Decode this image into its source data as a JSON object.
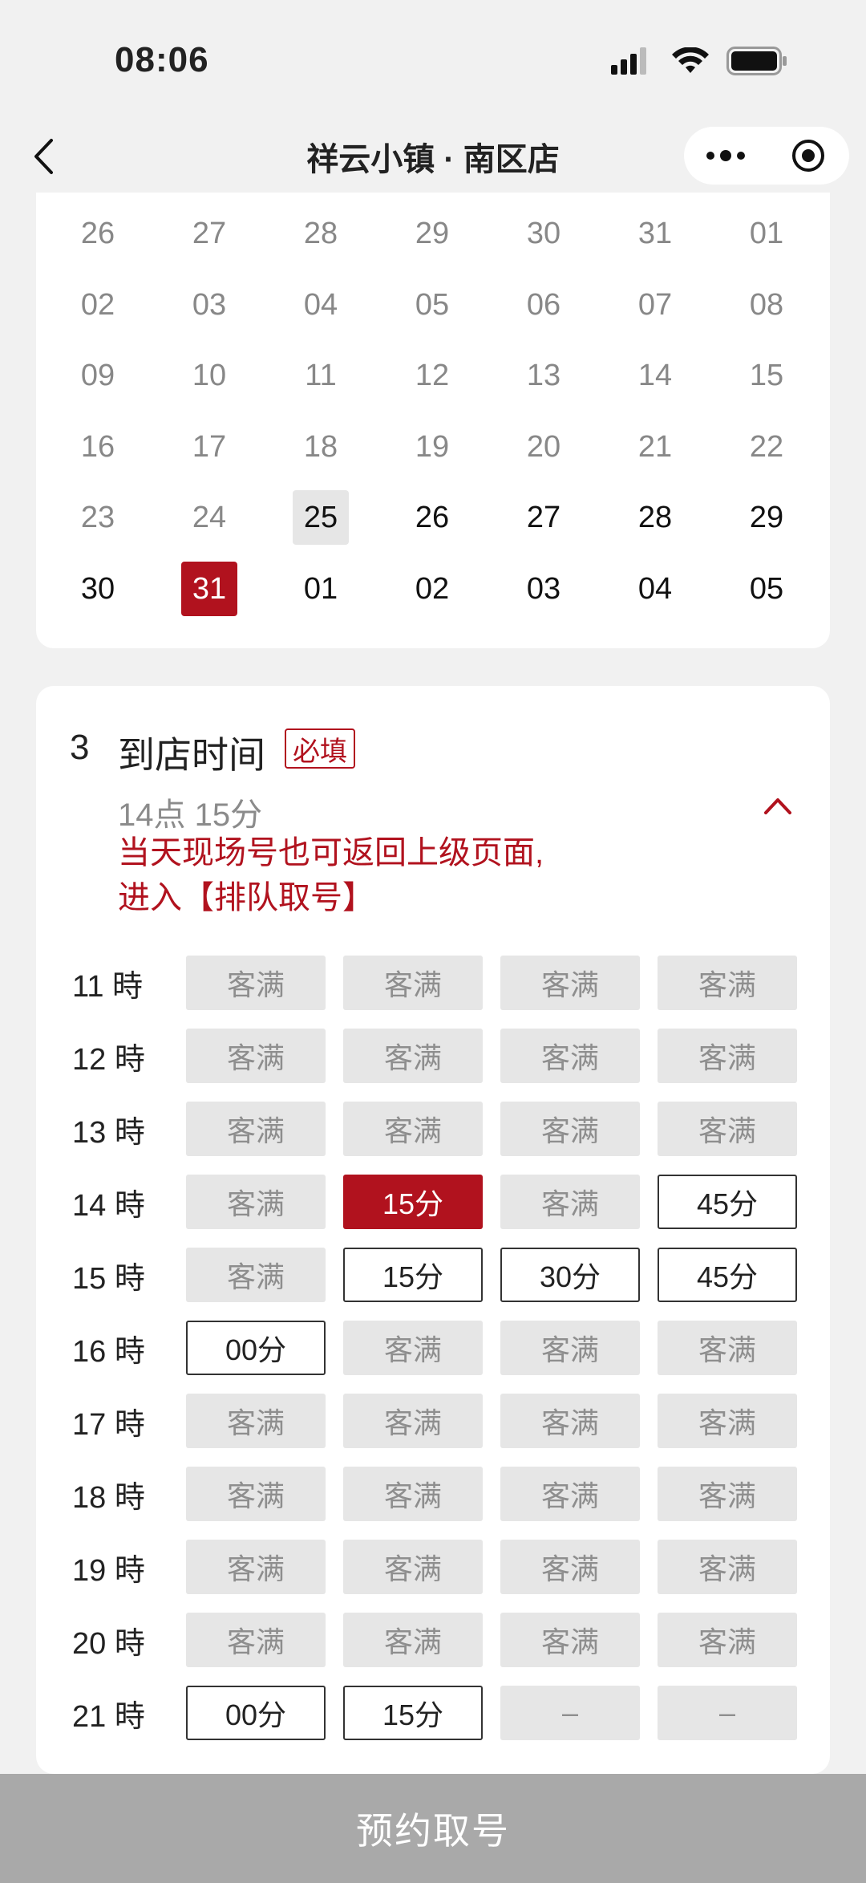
{
  "status": {
    "time": "08:06"
  },
  "nav": {
    "title": "祥云小镇 · 南区店"
  },
  "calendar": {
    "rows": [
      [
        {
          "d": "26",
          "s": "past"
        },
        {
          "d": "27",
          "s": "past"
        },
        {
          "d": "28",
          "s": "past"
        },
        {
          "d": "29",
          "s": "past"
        },
        {
          "d": "30",
          "s": "past"
        },
        {
          "d": "31",
          "s": "past"
        },
        {
          "d": "01",
          "s": "past"
        }
      ],
      [
        {
          "d": "02",
          "s": "past"
        },
        {
          "d": "03",
          "s": "past"
        },
        {
          "d": "04",
          "s": "past"
        },
        {
          "d": "05",
          "s": "past"
        },
        {
          "d": "06",
          "s": "past"
        },
        {
          "d": "07",
          "s": "past"
        },
        {
          "d": "08",
          "s": "past"
        }
      ],
      [
        {
          "d": "09",
          "s": "past"
        },
        {
          "d": "10",
          "s": "past"
        },
        {
          "d": "11",
          "s": "past"
        },
        {
          "d": "12",
          "s": "past"
        },
        {
          "d": "13",
          "s": "past"
        },
        {
          "d": "14",
          "s": "past"
        },
        {
          "d": "15",
          "s": "past"
        }
      ],
      [
        {
          "d": "16",
          "s": "past"
        },
        {
          "d": "17",
          "s": "past"
        },
        {
          "d": "18",
          "s": "past"
        },
        {
          "d": "19",
          "s": "past"
        },
        {
          "d": "20",
          "s": "past"
        },
        {
          "d": "21",
          "s": "past"
        },
        {
          "d": "22",
          "s": "past"
        }
      ],
      [
        {
          "d": "23",
          "s": "past"
        },
        {
          "d": "24",
          "s": "past"
        },
        {
          "d": "25",
          "s": "today"
        },
        {
          "d": "26",
          "s": "future"
        },
        {
          "d": "27",
          "s": "future"
        },
        {
          "d": "28",
          "s": "future"
        },
        {
          "d": "29",
          "s": "future"
        }
      ],
      [
        {
          "d": "30",
          "s": "future"
        },
        {
          "d": "31",
          "s": "selected"
        },
        {
          "d": "01",
          "s": "future"
        },
        {
          "d": "02",
          "s": "future"
        },
        {
          "d": "03",
          "s": "future"
        },
        {
          "d": "04",
          "s": "future"
        },
        {
          "d": "05",
          "s": "future"
        }
      ]
    ]
  },
  "time_section": {
    "step_number": "3",
    "title": "到店时间",
    "required_label": "必填",
    "selected_time": "14点 15分",
    "notice_line1": "当天现场号也可返回上级页面,",
    "notice_line2": "进入【排队取号】",
    "rows": [
      {
        "hour": "11 時",
        "slots": [
          {
            "t": "客满",
            "s": "full"
          },
          {
            "t": "客满",
            "s": "full"
          },
          {
            "t": "客满",
            "s": "full"
          },
          {
            "t": "客满",
            "s": "full"
          }
        ]
      },
      {
        "hour": "12 時",
        "slots": [
          {
            "t": "客满",
            "s": "full"
          },
          {
            "t": "客满",
            "s": "full"
          },
          {
            "t": "客满",
            "s": "full"
          },
          {
            "t": "客满",
            "s": "full"
          }
        ]
      },
      {
        "hour": "13 時",
        "slots": [
          {
            "t": "客满",
            "s": "full"
          },
          {
            "t": "客满",
            "s": "full"
          },
          {
            "t": "客满",
            "s": "full"
          },
          {
            "t": "客满",
            "s": "full"
          }
        ]
      },
      {
        "hour": "14 時",
        "slots": [
          {
            "t": "客满",
            "s": "full"
          },
          {
            "t": "15分",
            "s": "selected"
          },
          {
            "t": "客满",
            "s": "full"
          },
          {
            "t": "45分",
            "s": "available"
          }
        ]
      },
      {
        "hour": "15 時",
        "slots": [
          {
            "t": "客满",
            "s": "full"
          },
          {
            "t": "15分",
            "s": "available"
          },
          {
            "t": "30分",
            "s": "available"
          },
          {
            "t": "45分",
            "s": "available"
          }
        ]
      },
      {
        "hour": "16 時",
        "slots": [
          {
            "t": "00分",
            "s": "available"
          },
          {
            "t": "客满",
            "s": "full"
          },
          {
            "t": "客满",
            "s": "full"
          },
          {
            "t": "客满",
            "s": "full"
          }
        ]
      },
      {
        "hour": "17 時",
        "slots": [
          {
            "t": "客满",
            "s": "full"
          },
          {
            "t": "客满",
            "s": "full"
          },
          {
            "t": "客满",
            "s": "full"
          },
          {
            "t": "客满",
            "s": "full"
          }
        ]
      },
      {
        "hour": "18 時",
        "slots": [
          {
            "t": "客满",
            "s": "full"
          },
          {
            "t": "客满",
            "s": "full"
          },
          {
            "t": "客满",
            "s": "full"
          },
          {
            "t": "客满",
            "s": "full"
          }
        ]
      },
      {
        "hour": "19 時",
        "slots": [
          {
            "t": "客满",
            "s": "full"
          },
          {
            "t": "客满",
            "s": "full"
          },
          {
            "t": "客满",
            "s": "full"
          },
          {
            "t": "客满",
            "s": "full"
          }
        ]
      },
      {
        "hour": "20 時",
        "slots": [
          {
            "t": "客满",
            "s": "full"
          },
          {
            "t": "客满",
            "s": "full"
          },
          {
            "t": "客满",
            "s": "full"
          },
          {
            "t": "客满",
            "s": "full"
          }
        ]
      },
      {
        "hour": "21 時",
        "slots": [
          {
            "t": "00分",
            "s": "available"
          },
          {
            "t": "15分",
            "s": "available"
          },
          {
            "t": "–",
            "s": "empty"
          },
          {
            "t": "–",
            "s": "empty"
          }
        ]
      }
    ]
  },
  "submit": {
    "label": "预约取号"
  },
  "colors": {
    "accent": "#b1121e",
    "slot_full_bg": "#e6e6e6",
    "submit_bg": "#a9a9a9"
  }
}
